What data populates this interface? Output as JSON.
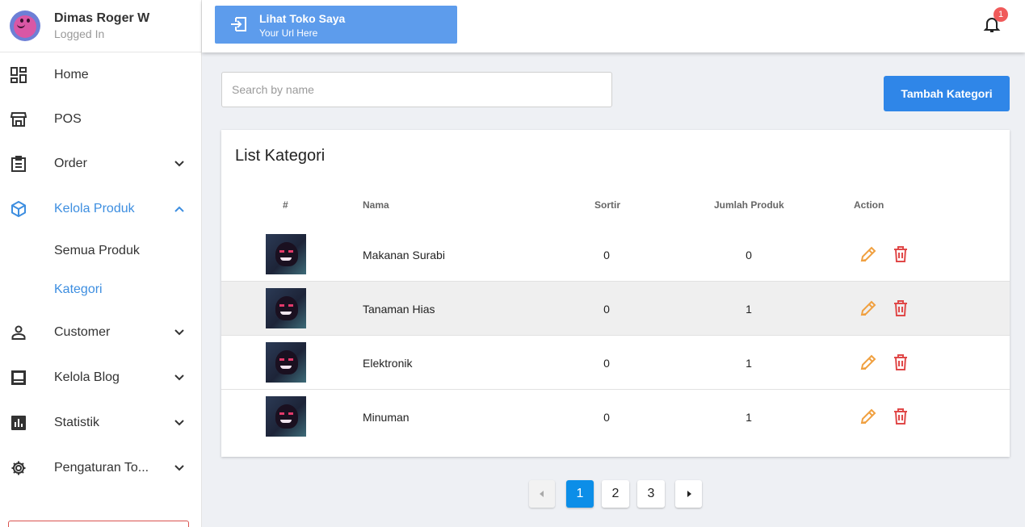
{
  "user": {
    "name": "Dimas Roger W",
    "status": "Logged In"
  },
  "nav": {
    "home": "Home",
    "pos": "POS",
    "order": "Order",
    "kelola_produk": "Kelola Produk",
    "semua_produk": "Semua Produk",
    "kategori": "Kategori",
    "customer": "Customer",
    "kelola_blog": "Kelola Blog",
    "statistik": "Statistik",
    "pengaturan": "Pengaturan To..."
  },
  "topbar": {
    "store_title": "Lihat Toko Saya",
    "store_url": "Your Url Here",
    "notification_count": "1"
  },
  "search": {
    "placeholder": "Search by name"
  },
  "add_button": "Tambah Kategori",
  "card": {
    "title": "List Kategori",
    "headers": {
      "index": "#",
      "name": "Nama",
      "sort": "Sortir",
      "count": "Jumlah Produk",
      "action": "Action"
    },
    "rows": [
      {
        "name": "Makanan Surabi",
        "sort": "0",
        "count": "0"
      },
      {
        "name": "Tanaman Hias",
        "sort": "0",
        "count": "1"
      },
      {
        "name": "Elektronik",
        "sort": "0",
        "count": "1"
      },
      {
        "name": "Minuman",
        "sort": "0",
        "count": "1"
      }
    ]
  },
  "pagination": {
    "pages": [
      "1",
      "2",
      "3"
    ],
    "current": "1"
  },
  "colors": {
    "accent": "#3d8ee0",
    "primary_button": "#2f86e8",
    "edit": "#f0a040",
    "delete": "#e04848",
    "badge": "#f05a5a"
  },
  "icons": [
    "dashboard-icon",
    "store-icon",
    "clipboard-icon",
    "box-icon",
    "person-icon",
    "article-icon",
    "chart-icon",
    "gear-icon",
    "login-icon",
    "bell-icon",
    "pencil-icon",
    "trash-icon",
    "chevron-down-icon",
    "chevron-up-icon",
    "caret-left-icon",
    "caret-right-icon"
  ]
}
